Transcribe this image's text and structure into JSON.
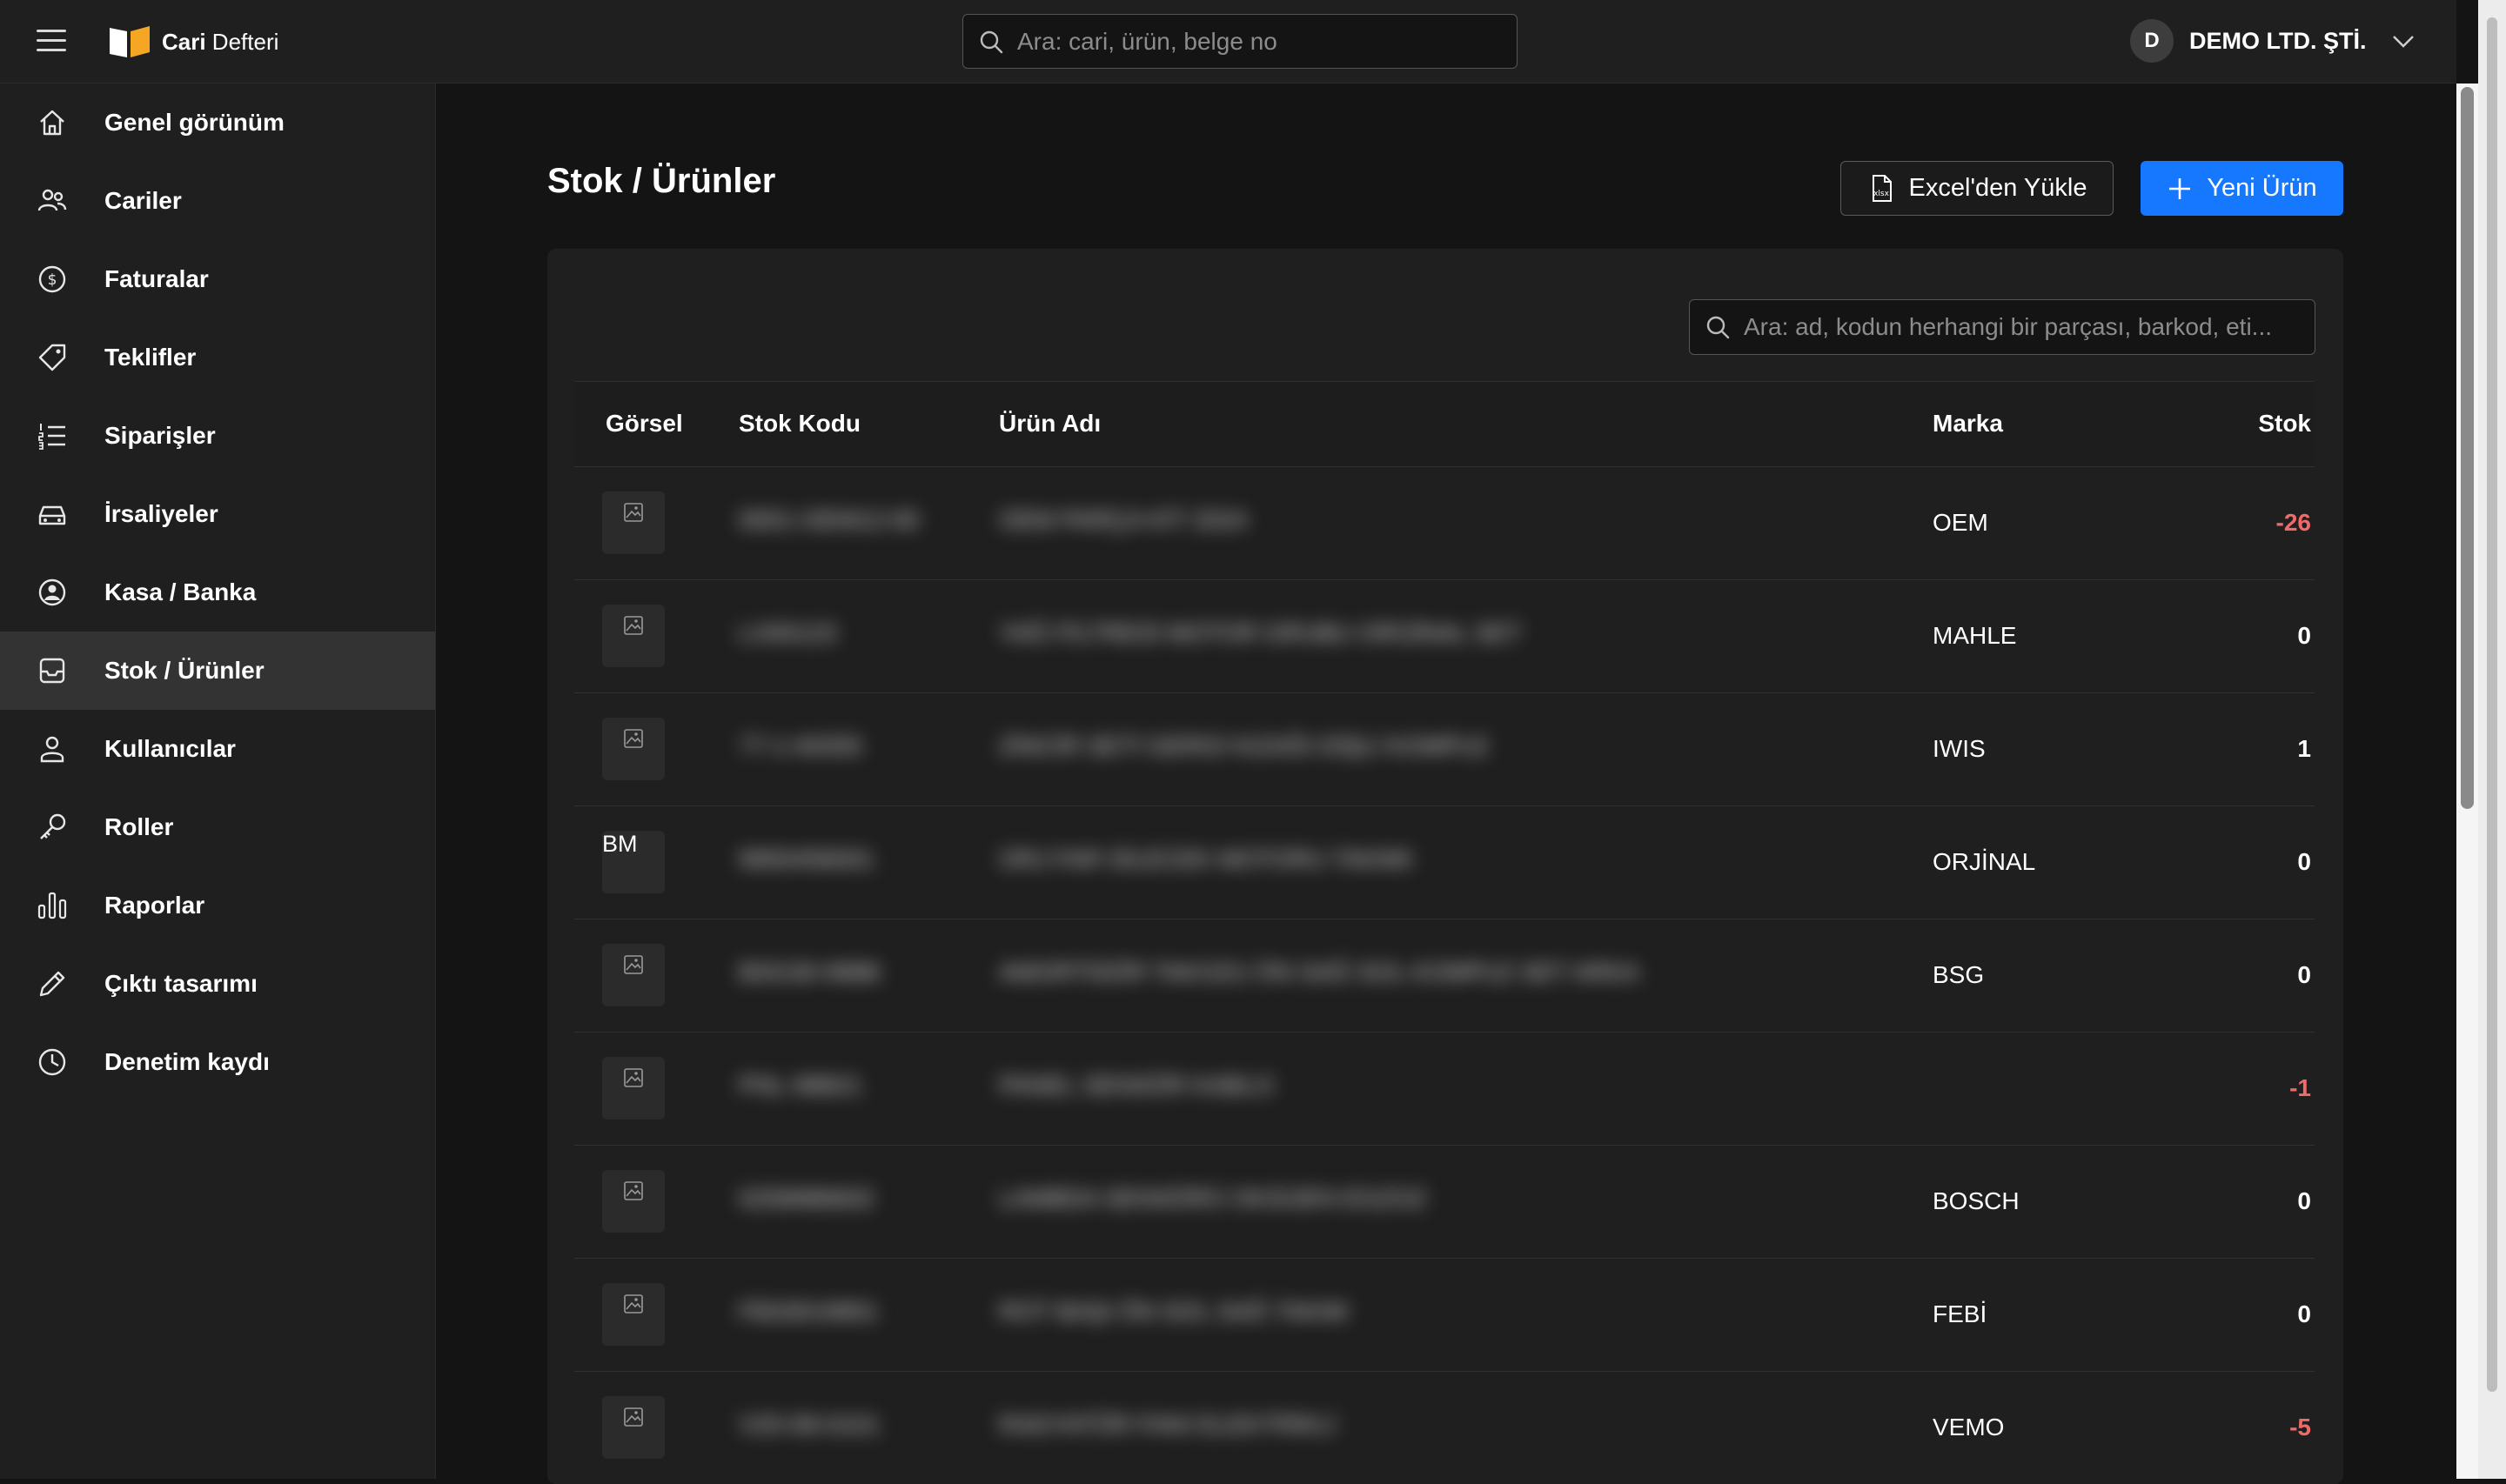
{
  "app": {
    "logo_bold": "Cari",
    "logo_regular": " Defteri",
    "search_placeholder": "Ara: cari, ürün, belge no",
    "user_initial": "D",
    "company_name": "DEMO LTD. ŞTİ."
  },
  "sidebar": {
    "items": [
      {
        "label": "Genel görünüm",
        "icon": "home-icon"
      },
      {
        "label": "Cariler",
        "icon": "users-icon"
      },
      {
        "label": "Faturalar",
        "icon": "dollar-circle-icon"
      },
      {
        "label": "Teklifler",
        "icon": "tag-icon"
      },
      {
        "label": "Siparişler",
        "icon": "ordered-list-icon"
      },
      {
        "label": "İrsaliyeler",
        "icon": "car-icon"
      },
      {
        "label": "Kasa / Banka",
        "icon": "wallet-circle-icon"
      },
      {
        "label": "Stok / Ürünler",
        "icon": "inbox-icon",
        "active": true
      },
      {
        "label": "Kullanıcılar",
        "icon": "user-icon"
      },
      {
        "label": "Roller",
        "icon": "key-icon"
      },
      {
        "label": "Raporlar",
        "icon": "bar-chart-icon"
      },
      {
        "label": "Çıktı tasarımı",
        "icon": "pencil-icon"
      },
      {
        "label": "Denetim kaydı",
        "icon": "clock-icon"
      }
    ]
  },
  "page": {
    "title": "Stok / Ürünler",
    "excel_button": "Excel'den Yükle",
    "new_button": "Yeni Ürün",
    "table_search_placeholder": "Ara: ad, kodun herhangi bir parçası, barkod, eti..."
  },
  "table": {
    "columns": [
      "Görsel",
      "Stok Kodu",
      "Ürün Adı",
      "Marka",
      "Stok"
    ],
    "rows": [
      {
        "image": "placeholder",
        "code": "0001-OEM12-00",
        "name": "OEM PARÇA KİT 2024",
        "brand": "OEM",
        "stock": "-26"
      },
      {
        "image": "placeholder",
        "code": "LX00123",
        "name": "YAĞ FİLTRESİ MOTOR GRUBU ORİJİNAL SET",
        "brand": "MAHLE",
        "stock": "0"
      },
      {
        "image": "placeholder",
        "code": "77-1-WS55",
        "name": "ZİNCİR SETİ GERGİ KIZAĞI DİŞLİ KOMPLE",
        "brand": "IWIS",
        "stock": "1"
      },
      {
        "image": "broken",
        "alt": "BM",
        "code": "9900456001",
        "name": "ORJ FAR SİLECEK MOTORU TAKIMI",
        "brand": "ORJİNAL",
        "stock": "0"
      },
      {
        "image": "placeholder",
        "code": "BSG30-9988",
        "name": "AMORTİSÖR TAKOZU ÖN SAĞ SOL KOMPLE SET ARKA",
        "brand": "BSG",
        "stock": "0"
      },
      {
        "image": "placeholder",
        "code": "PNL-98821",
        "name": "PANEL SENSÖR KABLO",
        "brand": "",
        "stock": "-1"
      },
      {
        "image": "placeholder",
        "code": "0258986602",
        "name": "LAMBDA SENSÖRÜ OKSİJEN EGZOZ",
        "brand": "BOSCH",
        "stock": "0"
      },
      {
        "image": "placeholder",
        "code": "FB33019901",
        "name": "ROT BAŞI ÖN SOL SAĞ TAKIM",
        "brand": "FEBİ",
        "stock": "0"
      },
      {
        "image": "placeholder",
        "code": "V20-08-0101",
        "name": "RADYATÖR FANI ELEKTRİKLİ",
        "brand": "VEMO",
        "stock": "-5"
      }
    ]
  },
  "colors": {
    "primary": "#1677ff",
    "negative": "#f06a6a",
    "active_nav": "#333333"
  }
}
